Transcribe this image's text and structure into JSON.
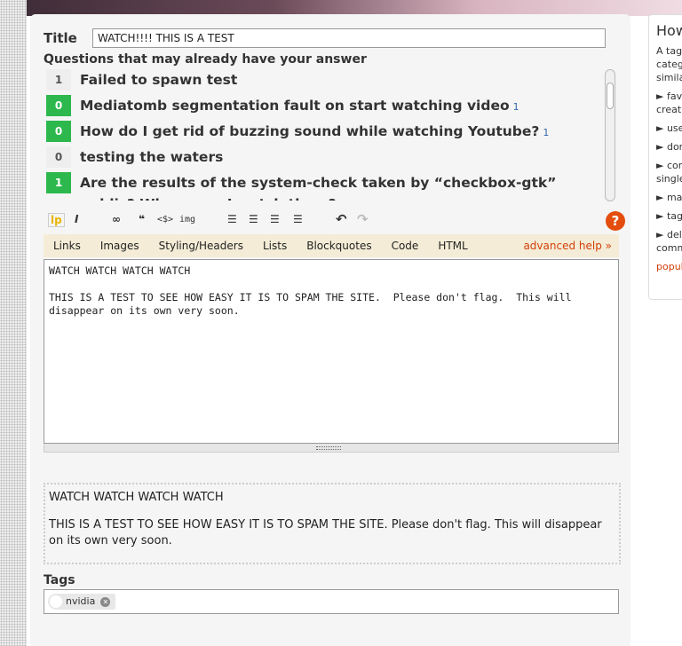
{
  "title": {
    "label": "Title",
    "value": "WATCH!!!! THIS IS A TEST"
  },
  "similar": {
    "heading": "Questions that may already have your answer",
    "items": [
      {
        "votes": "1",
        "answered": false,
        "title": "Failed to spawn test",
        "answers": ""
      },
      {
        "votes": "0",
        "answered": true,
        "title": "Mediatomb segmentation fault on start watching video",
        "answers": "1"
      },
      {
        "votes": "0",
        "answered": true,
        "title": "How do I get rid of buzzing sound while watching Youtube?",
        "answers": "1"
      },
      {
        "votes": "0",
        "answered": false,
        "title": "testing the waters",
        "answers": ""
      },
      {
        "votes": "1",
        "answered": true,
        "title": "Are the results of the system-check taken by “checkbox-gtk” public? Where can I watch them?",
        "answers": "1"
      }
    ]
  },
  "toolbar": {
    "bold": "lp",
    "italic": "I",
    "link": "∞",
    "quote": "❝",
    "code": "<$>",
    "image": "img",
    "ol": "☰",
    "ul": "☰",
    "heading": "☰",
    "hr": "☰",
    "undo": "↶",
    "redo": "↷",
    "help": "?"
  },
  "help_tabs": [
    "Links",
    "Images",
    "Styling/Headers",
    "Lists",
    "Blockquotes",
    "Code",
    "HTML"
  ],
  "advanced_help": "advanced help »",
  "editor_text": "WATCH WATCH WATCH WATCH\n\nTHIS IS A TEST TO SEE HOW EASY IT IS TO SPAM THE SITE.  Please don't flag.  This will\ndisappear on its own very soon.",
  "preview": {
    "p1": "WATCH WATCH WATCH WATCH",
    "p2": "THIS IS A TEST TO SEE HOW EASY IT IS TO SPAM THE SITE. Please don't flag. This will disappear on its own very soon."
  },
  "tags": {
    "label": "Tags",
    "items": [
      "nvidia"
    ]
  },
  "sidebar": {
    "heading": "How",
    "lines": [
      "A tag",
      "categ",
      "simila",
      "► favo",
      "creati",
      "► use",
      "► don",
      "► com",
      "single",
      "► max",
      "► tag",
      "► deli",
      "comm"
    ],
    "link": "popul"
  }
}
